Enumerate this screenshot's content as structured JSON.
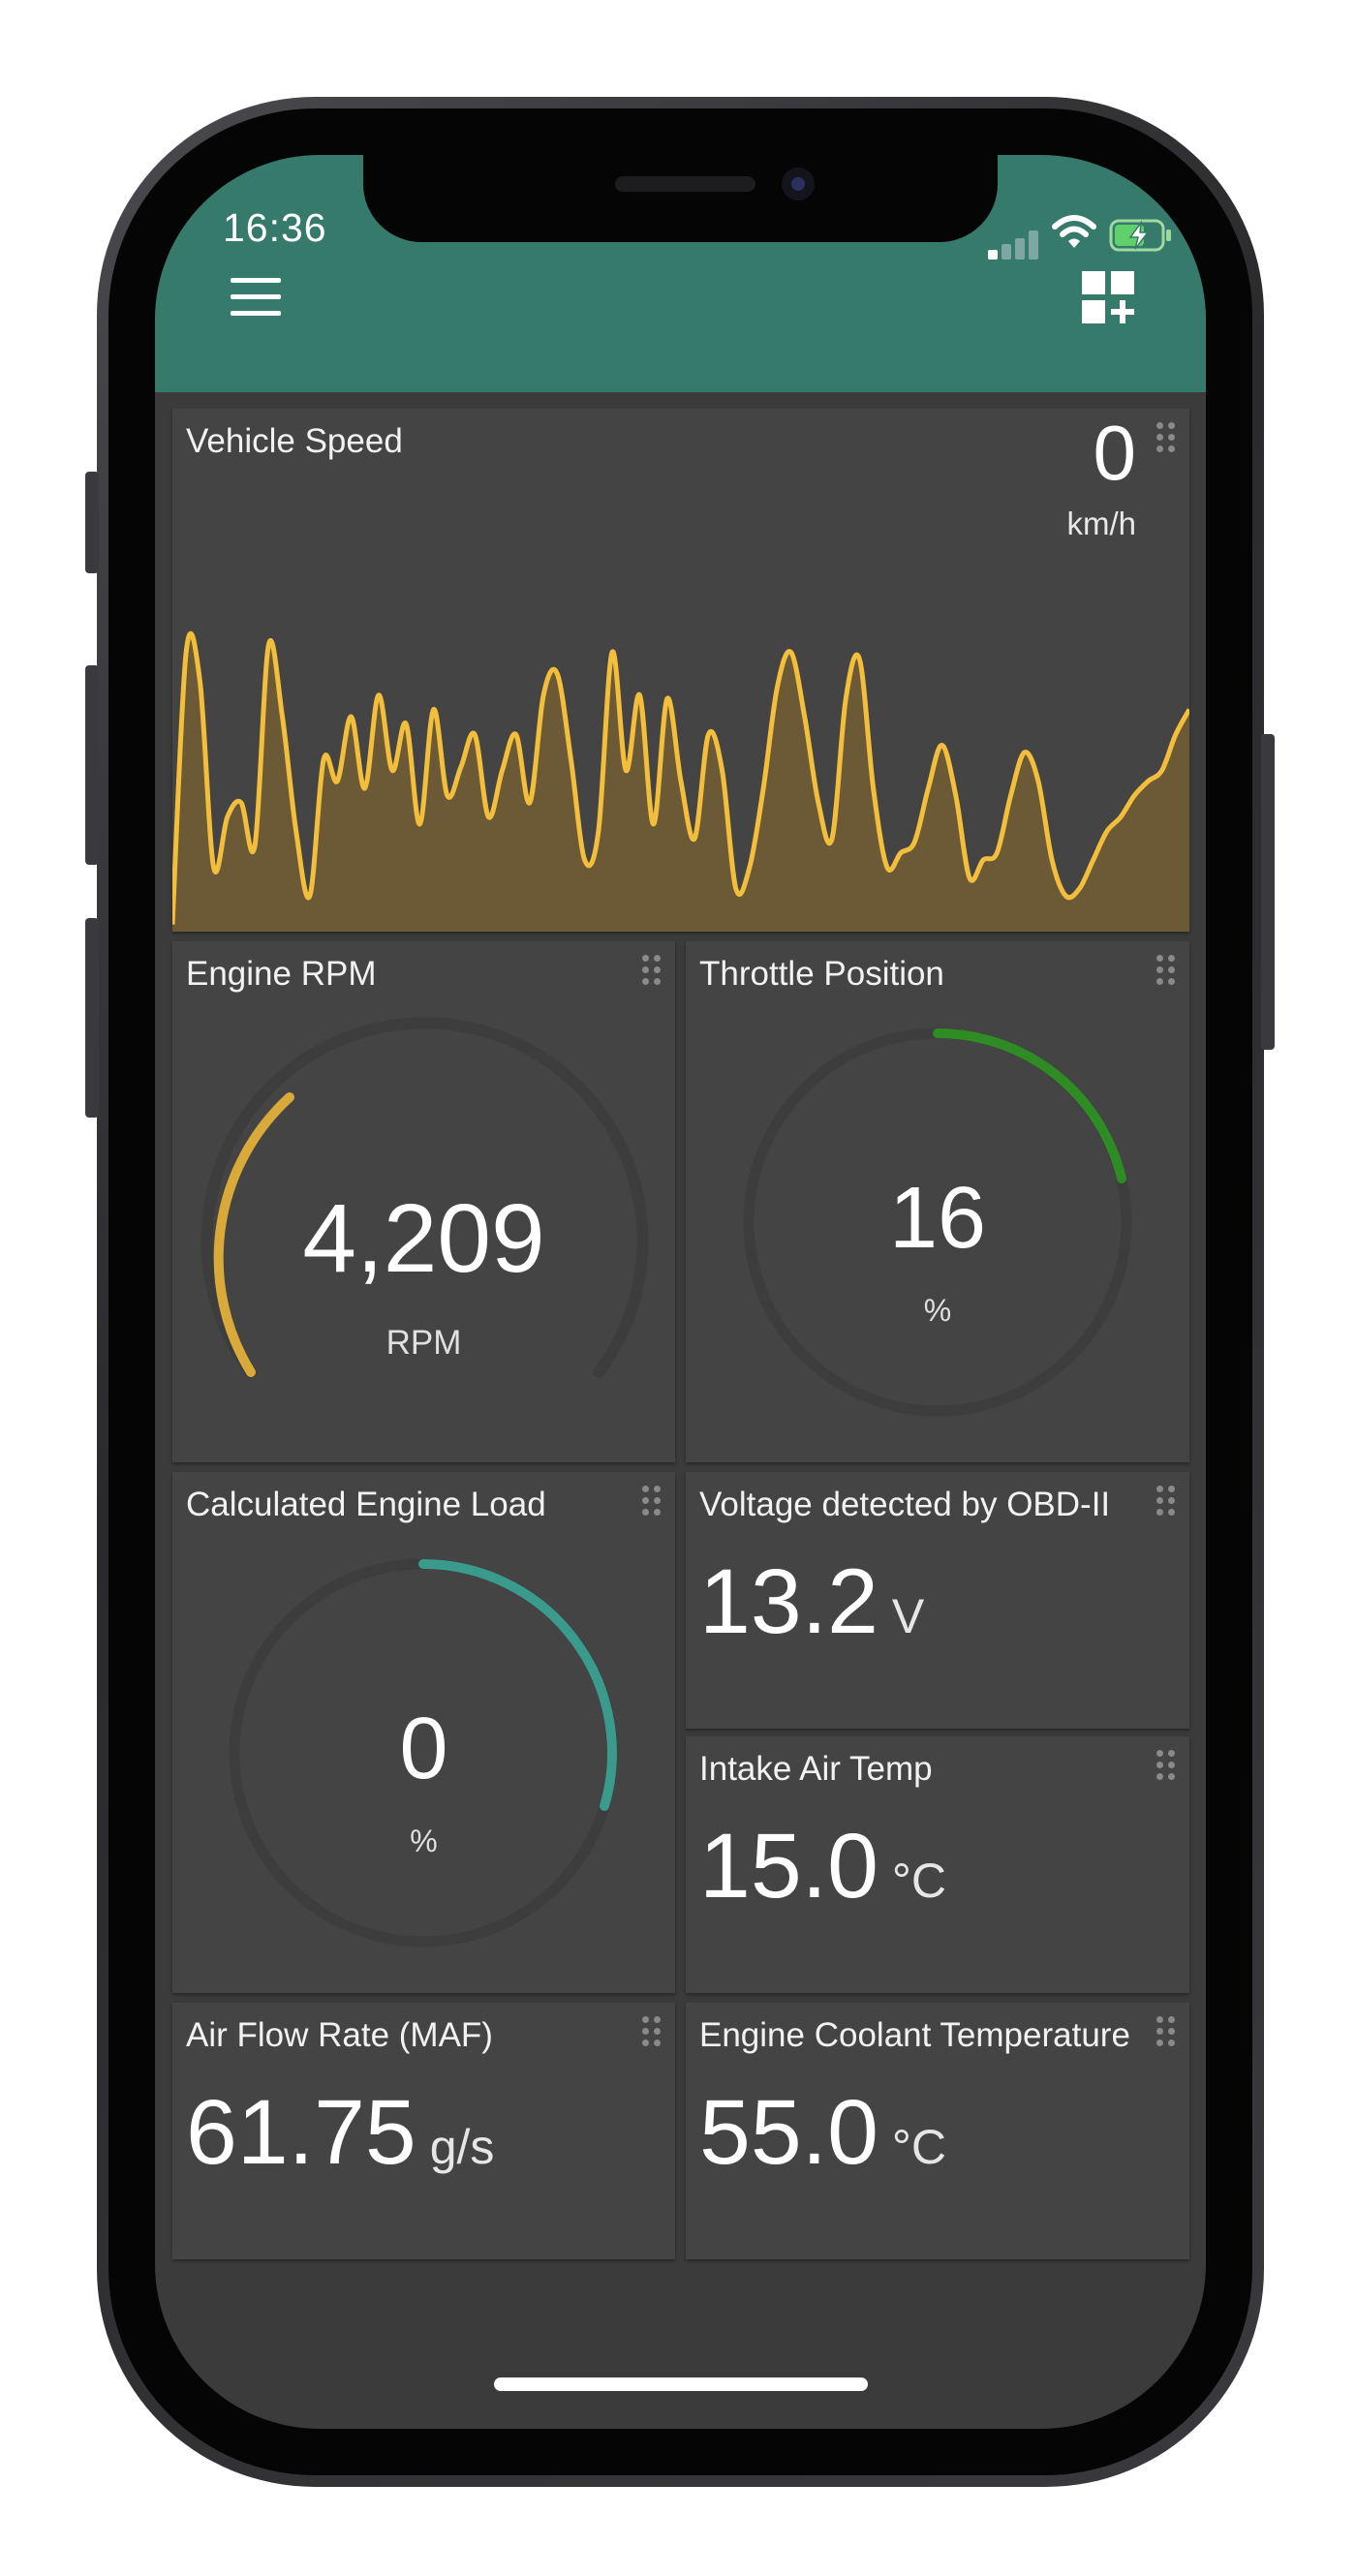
{
  "status_bar": {
    "time": "16:36"
  },
  "header": {
    "background_color": "#367a6c",
    "menu_icon": "hamburger-menu-icon",
    "add_icon": "add-widget-icon"
  },
  "widgets": {
    "vehicle_speed": {
      "title": "Vehicle Speed",
      "value": "0",
      "unit": "km/h",
      "line_color": "#f2be3c",
      "fill_color": "#6b5a35"
    },
    "engine_rpm": {
      "title": "Engine RPM",
      "value": "4,209",
      "unit": "RPM",
      "gauge_color": "#d9a93a",
      "gauge_fraction": 0.2
    },
    "throttle_position": {
      "title": "Throttle Position",
      "value": "16",
      "unit": "%",
      "gauge_color": "#2f8c24",
      "gauge_fraction": 0.16
    },
    "calculated_engine_load": {
      "title": "Calculated Engine Load",
      "value": "0",
      "unit": "%",
      "gauge_color": "#3a9a8c",
      "gauge_fraction": 0.3
    },
    "voltage": {
      "title": "Voltage detected by OBD-II",
      "value": "13.2",
      "unit": "V"
    },
    "intake_air_temp": {
      "title": "Intake Air Temp",
      "value": "15.0",
      "unit": "°C"
    },
    "air_flow_rate": {
      "title": "Air Flow Rate (MAF)",
      "value": "61.75",
      "unit": "g/s"
    },
    "engine_coolant_temp": {
      "title": "Engine Coolant Temperature",
      "value": "55.0",
      "unit": "°C"
    }
  },
  "chart_data": {
    "type": "area",
    "title": "Vehicle Speed",
    "xlabel": "",
    "ylabel": "",
    "y": [
      2,
      78,
      70,
      18,
      32,
      36,
      24,
      80,
      60,
      28,
      10,
      48,
      42,
      60,
      40,
      66,
      45,
      58,
      30,
      62,
      38,
      46,
      55,
      32,
      45,
      55,
      36,
      66,
      72,
      48,
      20,
      28,
      78,
      45,
      66,
      30,
      65,
      42,
      26,
      55,
      45,
      12,
      18,
      40,
      68,
      78,
      60,
      36,
      26,
      65,
      76,
      40,
      18,
      22,
      25,
      40,
      52,
      38,
      15,
      20,
      22,
      38,
      50,
      42,
      20,
      10,
      12,
      20,
      28,
      32,
      38,
      42,
      45,
      55,
      62
    ],
    "grid": false
  }
}
